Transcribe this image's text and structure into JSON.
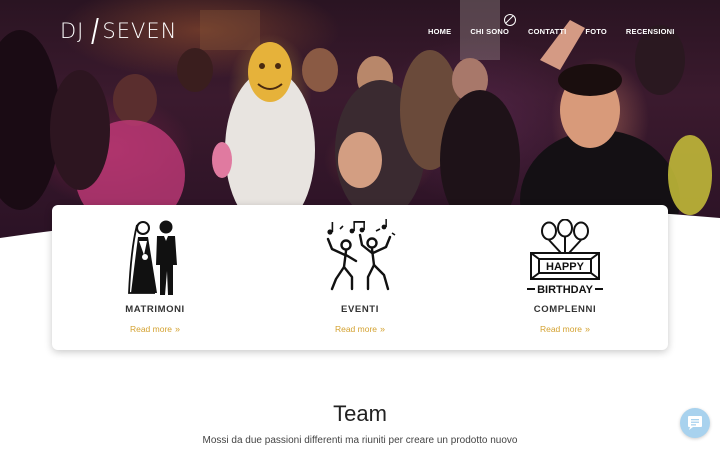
{
  "brand": {
    "logo_left": "DJ",
    "logo_right": "SEVEN"
  },
  "nav": {
    "items": [
      "HOME",
      "CHI SONO",
      "CONTATTI",
      "FOTO",
      "RECENSIONI"
    ]
  },
  "services": [
    {
      "title": "MATRIMONI",
      "link": "Read more",
      "icon": "wedding-couple-icon"
    },
    {
      "title": "EVENTI",
      "link": "Read more",
      "icon": "dancing-people-icon"
    },
    {
      "title": "COMPLENNI",
      "link": "Read more",
      "icon": "happy-birthday-icon",
      "icon_text_top": "HAPPY",
      "icon_text_bottom": "BIRTHDAY"
    }
  ],
  "team": {
    "title": "Team",
    "subtitle": "Mossi da due passioni differenti ma riuniti per creare un prodotto nuovo"
  },
  "colors": {
    "accent": "#d4a231",
    "chat": "#a8d2ee"
  }
}
